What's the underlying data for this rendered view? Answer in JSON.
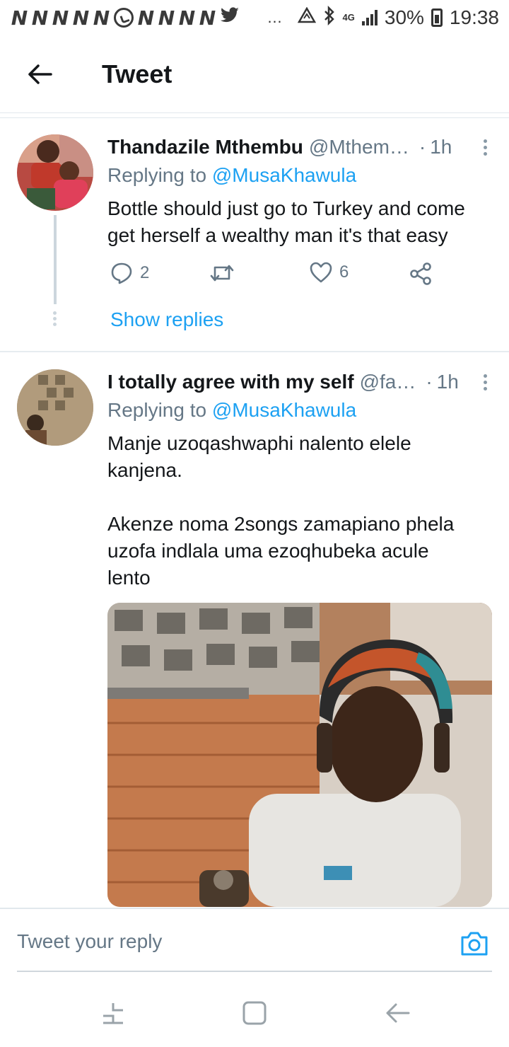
{
  "status_bar": {
    "notification_icons": [
      "N",
      "N",
      "N",
      "N",
      "N",
      "whatsapp-icon",
      "N",
      "N",
      "N",
      "N",
      "twitter-icon"
    ],
    "more_indicator": "…",
    "network": "4G",
    "battery_percent": "30%",
    "time": "19:38"
  },
  "header": {
    "title": "Tweet"
  },
  "tweets": [
    {
      "author_name": "Thandazile Mthembu",
      "handle": "@Mthem…",
      "separator": "·",
      "time": "1h",
      "replying_prefix": "Replying to ",
      "replying_to": "@MusaKhawula",
      "text": "Bottle should just go to Turkey and come\nget herself a wealthy man it's that easy",
      "reply_count": "2",
      "retweet_count": "",
      "like_count": "6",
      "show_replies_label": "Show replies"
    },
    {
      "author_name": "I totally agree with my self",
      "handle": "@fa…",
      "separator": "·",
      "time": "1h",
      "replying_prefix": "Replying to ",
      "replying_to": "@MusaKhawula",
      "text": "Manje uzoqashwaphi nalento elele\nkanjena.\n\nAkenze noma 2songs zamapiano phela\nuzofa indlala uma ezoqhubeka acule\nlento"
    }
  ],
  "reply_bar": {
    "placeholder": "Tweet your reply"
  },
  "colors": {
    "accent": "#1da1f2",
    "secondary_text": "#657786",
    "primary_text": "#14171a",
    "divider": "#e6ecf0"
  }
}
